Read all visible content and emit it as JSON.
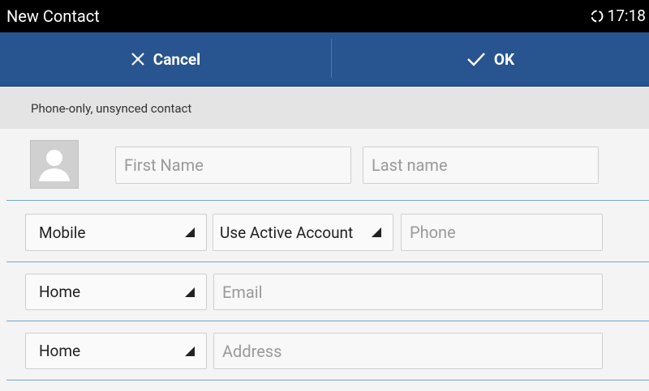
{
  "statusbar": {
    "title": "New Contact",
    "time": "17:18"
  },
  "actionbar": {
    "cancel_label": "Cancel",
    "ok_label": "OK"
  },
  "account": {
    "label": "Phone-only, unsynced contact"
  },
  "name": {
    "first_placeholder": "First Name",
    "last_placeholder": "Last name"
  },
  "phone": {
    "type": "Mobile",
    "account": "Use Active Account",
    "placeholder": "Phone"
  },
  "email": {
    "type": "Home",
    "placeholder": "Email"
  },
  "address": {
    "type": "Home",
    "placeholder": "Address"
  },
  "colors": {
    "statusbar": "#000000",
    "actionbar": "#28548f",
    "divider": "#6fa3cf",
    "background": "#f4f4f4"
  }
}
